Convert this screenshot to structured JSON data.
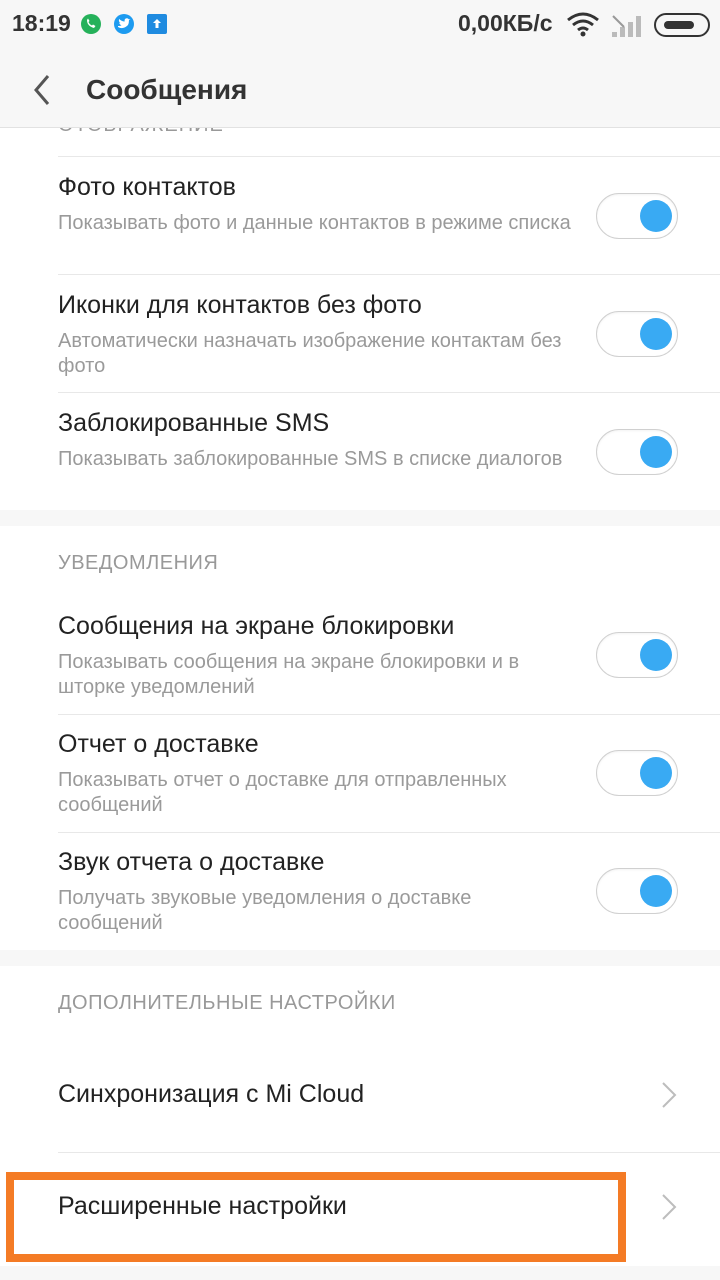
{
  "status": {
    "time": "18:19",
    "net_speed": "0,00КБ/с",
    "icons": [
      "whatsapp-icon",
      "twitter-icon",
      "upload-icon",
      "wifi-icon",
      "signal-icon",
      "battery-icon"
    ]
  },
  "header": {
    "title": "Сообщения",
    "back_icon": "chevron-left-icon"
  },
  "display_section": {
    "header_partial": "ОТОБРАЖЕНИЕ",
    "items": [
      {
        "title": "Фото контактов",
        "subtitle": "Показывать фото и данные контактов в режиме списка",
        "enabled": true
      },
      {
        "title": "Иконки для контактов без фото",
        "subtitle": "Автоматически назначать изображение контактам без фото",
        "enabled": true
      },
      {
        "title": "Заблокированные SMS",
        "subtitle": "Показывать заблокированные SMS в списке диалогов",
        "enabled": true
      }
    ]
  },
  "notifications_section": {
    "header": "УВЕДОМЛЕНИЯ",
    "items": [
      {
        "title": "Сообщения на экране блокировки",
        "subtitle": "Показывать сообщения на экране блокировки и в шторке уведомлений",
        "enabled": true
      },
      {
        "title": "Отчет о доставке",
        "subtitle": "Показывать отчет о доставке для отправленных сообщений",
        "enabled": true
      },
      {
        "title": "Звук отчета о доставке",
        "subtitle": "Получать звуковые уведомления о доставке сообщений",
        "enabled": true
      }
    ]
  },
  "advanced_section": {
    "header": "ДОПОЛНИТЕЛЬНЫЕ НАСТРОЙКИ",
    "items": [
      {
        "title": "Синхронизация с Mi Cloud"
      },
      {
        "title": "Расширенные настройки"
      }
    ]
  },
  "colors": {
    "toggle_on": "#39aaf3",
    "highlight": "#f47b25",
    "background": "#f7f7f7"
  }
}
